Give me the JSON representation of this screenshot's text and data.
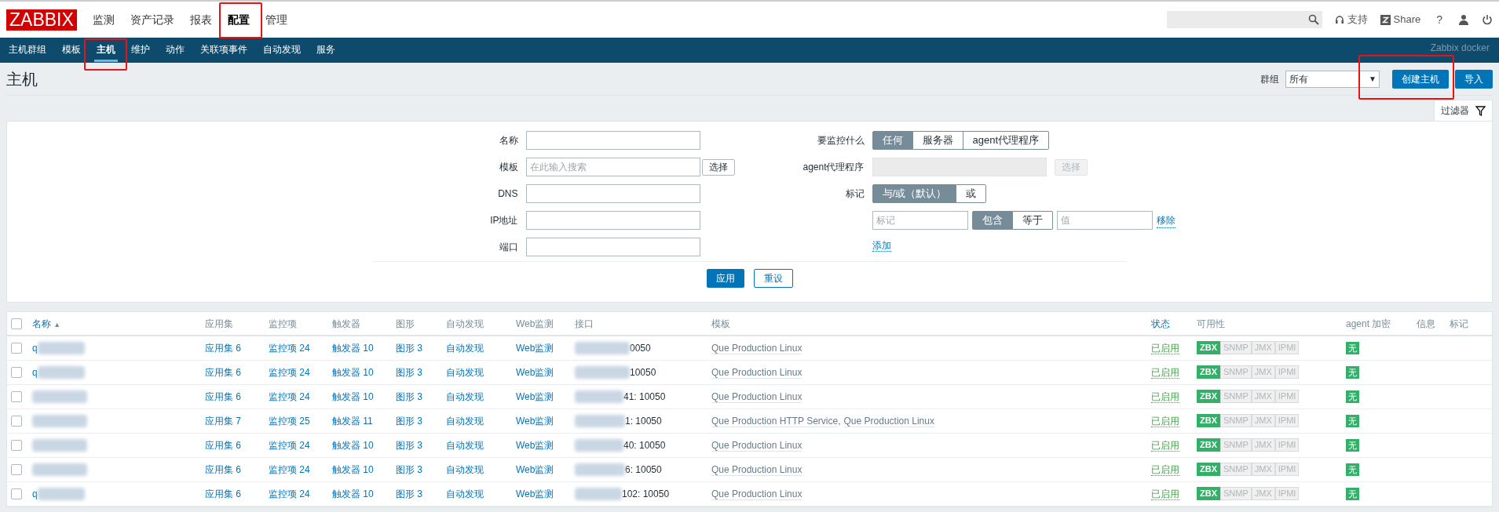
{
  "top_nav": {
    "logo": "ZABBIX",
    "menu": [
      {
        "label": "监测",
        "selected": false
      },
      {
        "label": "资产记录",
        "selected": false
      },
      {
        "label": "报表",
        "selected": false
      },
      {
        "label": "配置",
        "selected": true
      },
      {
        "label": "管理",
        "selected": false
      }
    ],
    "support": "支持",
    "share": "Share",
    "help": "?"
  },
  "sub_nav": {
    "items": [
      {
        "label": "主机群组",
        "selected": false
      },
      {
        "label": "模板",
        "selected": false
      },
      {
        "label": "主机",
        "selected": true
      },
      {
        "label": "维护",
        "selected": false
      },
      {
        "label": "动作",
        "selected": false
      },
      {
        "label": "关联项事件",
        "selected": false
      },
      {
        "label": "自动发现",
        "selected": false
      },
      {
        "label": "服务",
        "selected": false
      }
    ],
    "server_name": "Zabbix docker"
  },
  "page": {
    "title": "主机",
    "group_label": "群组",
    "group_value": "所有",
    "dropdown_arrow": "▼",
    "buttons": [
      {
        "label": "创建主机"
      },
      {
        "label": "导入"
      }
    ]
  },
  "filter_tab": {
    "label": "过滤器"
  },
  "filter": {
    "left": [
      {
        "label": "名称"
      },
      {
        "label": "模板",
        "placeholder": "在此输入搜索",
        "button": "选择"
      },
      {
        "label": "DNS"
      },
      {
        "label": "IP地址"
      },
      {
        "label": "端口"
      }
    ],
    "monitored_by": {
      "label": "要监控什么",
      "options": [
        {
          "label": "任何",
          "selected": true
        },
        {
          "label": "服务器",
          "selected": false
        },
        {
          "label": "agent代理程序",
          "selected": false
        }
      ]
    },
    "proxy": {
      "label": "agent代理程序",
      "button": "选择",
      "disabled": true
    },
    "tags": {
      "label": "标记",
      "operator": [
        {
          "label": "与/或（默认）",
          "selected": true
        },
        {
          "label": "或",
          "selected": false
        }
      ],
      "row": {
        "tag_placeholder": "标记",
        "match": [
          {
            "label": "包含",
            "selected": true
          },
          {
            "label": "等于",
            "selected": false
          }
        ],
        "value_placeholder": "值",
        "remove": "移除"
      },
      "add": "添加"
    },
    "apply": "应用",
    "reset": "重设"
  },
  "table": {
    "select_all_checked": false,
    "template_separator": ",",
    "columns": [
      {
        "label": "名称",
        "sort": "▲",
        "link": true
      },
      {
        "label": "应用集",
        "link": false
      },
      {
        "label": "监控项",
        "link": false
      },
      {
        "label": "触发器",
        "link": false
      },
      {
        "label": "图形",
        "link": false
      },
      {
        "label": "自动发现",
        "link": false
      },
      {
        "label": "Web监测",
        "link": false
      },
      {
        "label": "接口",
        "link": false
      },
      {
        "label": "模板",
        "link": false
      },
      {
        "label": "状态",
        "link": true
      },
      {
        "label": "可用性",
        "link": false
      },
      {
        "label": "agent 加密",
        "link": false
      },
      {
        "label": "信息",
        "link": false
      },
      {
        "label": "标记",
        "link": false
      }
    ],
    "rows": [
      {
        "checked": false,
        "name": "q",
        "applications": "应用集 6",
        "items": "监控项 24",
        "triggers": "触发器 10",
        "graphs": "图形 3",
        "discovery": "自动发现",
        "web": "Web监测",
        "interface": "0050",
        "templates": [
          "Que Production Linux"
        ],
        "status": "已启用",
        "availability": [
          {
            "label": "ZBX",
            "on": true
          },
          {
            "label": "SNMP",
            "on": false
          },
          {
            "label": "JMX",
            "on": false
          },
          {
            "label": "IPMI",
            "on": false
          }
        ],
        "encryption": "无"
      },
      {
        "checked": false,
        "name": "q",
        "applications": "应用集 6",
        "items": "监控项 24",
        "triggers": "触发器 10",
        "graphs": "图形 3",
        "discovery": "自动发现",
        "web": "Web监测",
        "interface": "10050",
        "templates": [
          "Que Production Linux"
        ],
        "status": "已启用",
        "availability": [
          {
            "label": "ZBX",
            "on": true
          },
          {
            "label": "SNMP",
            "on": false
          },
          {
            "label": "JMX",
            "on": false
          },
          {
            "label": "IPMI",
            "on": false
          }
        ],
        "encryption": "无"
      },
      {
        "checked": false,
        "applications": "应用集 6",
        "items": "监控项 24",
        "triggers": "触发器 10",
        "graphs": "图形 3",
        "discovery": "自动发现",
        "web": "Web监测",
        "interface": "41: 10050",
        "templates": [
          "Que Production Linux"
        ],
        "status": "已启用",
        "availability": [
          {
            "label": "ZBX",
            "on": true
          },
          {
            "label": "SNMP",
            "on": false
          },
          {
            "label": "JMX",
            "on": false
          },
          {
            "label": "IPMI",
            "on": false
          }
        ],
        "encryption": "无"
      },
      {
        "checked": false,
        "applications": "应用集 7",
        "items": "监控项 25",
        "triggers": "触发器 11",
        "graphs": "图形 3",
        "discovery": "自动发现",
        "web": "Web监测",
        "interface": "1: 10050",
        "templates": [
          "Que Production HTTP Service",
          "Que Production Linux"
        ],
        "status": "已启用",
        "availability": [
          {
            "label": "ZBX",
            "on": true
          },
          {
            "label": "SNMP",
            "on": false
          },
          {
            "label": "JMX",
            "on": false
          },
          {
            "label": "IPMI",
            "on": false
          }
        ],
        "encryption": "无"
      },
      {
        "checked": false,
        "applications": "应用集 6",
        "items": "监控项 24",
        "triggers": "触发器 10",
        "graphs": "图形 3",
        "discovery": "自动发现",
        "web": "Web监测",
        "interface": "40: 10050",
        "templates": [
          "Que Production Linux"
        ],
        "status": "已启用",
        "availability": [
          {
            "label": "ZBX",
            "on": true
          },
          {
            "label": "SNMP",
            "on": false
          },
          {
            "label": "JMX",
            "on": false
          },
          {
            "label": "IPMI",
            "on": false
          }
        ],
        "encryption": "无"
      },
      {
        "checked": false,
        "applications": "应用集 6",
        "items": "监控项 24",
        "triggers": "触发器 10",
        "graphs": "图形 3",
        "discovery": "自动发现",
        "web": "Web监测",
        "interface": "6: 10050",
        "templates": [
          "Que Production Linux"
        ],
        "status": "已启用",
        "availability": [
          {
            "label": "ZBX",
            "on": true
          },
          {
            "label": "SNMP",
            "on": false
          },
          {
            "label": "JMX",
            "on": false
          },
          {
            "label": "IPMI",
            "on": false
          }
        ],
        "encryption": "无"
      },
      {
        "checked": false,
        "name": "q",
        "applications": "应用集 6",
        "items": "监控项 24",
        "triggers": "触发器 10",
        "graphs": "图形 3",
        "discovery": "自动发现",
        "web": "Web监测",
        "interface": "102: 10050",
        "templates": [
          "Que Production Linux"
        ],
        "status": "已启用",
        "availability": [
          {
            "label": "ZBX",
            "on": true
          },
          {
            "label": "SNMP",
            "on": false
          },
          {
            "label": "JMX",
            "on": false
          },
          {
            "label": "IPMI",
            "on": false
          }
        ],
        "encryption": "无"
      }
    ]
  }
}
